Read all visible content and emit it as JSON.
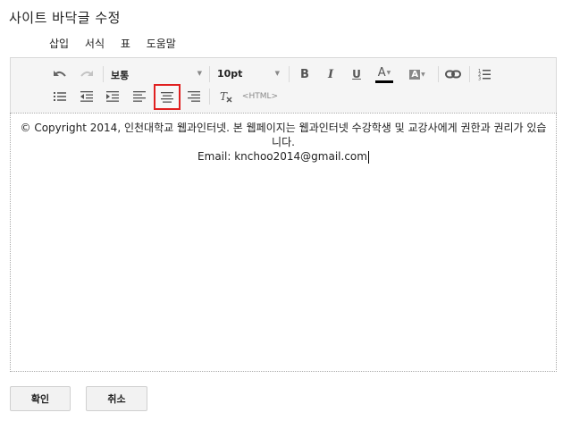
{
  "window": {
    "title": "사이트 바닥글 수정"
  },
  "menu": {
    "items": [
      "삽입",
      "서식",
      "표",
      "도움말"
    ]
  },
  "toolbar": {
    "style_value": "보통",
    "size_value": "10pt",
    "bold_glyph": "B",
    "italic_glyph": "I",
    "underline_glyph": "U",
    "fontcolor_glyph": "A",
    "highlight_glyph": "A",
    "html_label": "<HTML>",
    "accent_color": "#e02020"
  },
  "editor": {
    "line1": "© Copyright 2014, 인천대학교 웹과인터넷. 본 웹페이지는 웹과인터넷 수강학생 및 교강사에게 권한과 권리가 있습니다.",
    "line2": "Email: knchoo2014@gmail.com"
  },
  "buttons": {
    "ok": "확인",
    "cancel": "취소"
  }
}
